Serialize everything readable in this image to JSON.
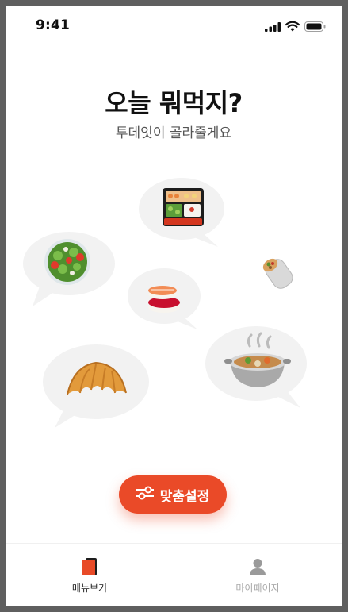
{
  "status_bar": {
    "time": "9:41"
  },
  "header": {
    "title": "오늘 뭐먹지?",
    "subtitle": "투데잇이 골라줄게요"
  },
  "food_bubbles": [
    {
      "name": "bento-box",
      "icon": "bento-box-icon"
    },
    {
      "name": "salad",
      "icon": "salad-icon"
    },
    {
      "name": "burrito",
      "icon": "burrito-icon"
    },
    {
      "name": "sushi",
      "icon": "sushi-icon"
    },
    {
      "name": "croissant",
      "icon": "croissant-icon"
    },
    {
      "name": "stew",
      "icon": "stew-icon"
    }
  ],
  "cta": {
    "label": "맞춤설정",
    "icon": "sliders-icon"
  },
  "tabbar": {
    "tabs": [
      {
        "label": "메뉴보기",
        "icon": "menu-book-icon",
        "active": true
      },
      {
        "label": "마이페이지",
        "icon": "person-icon",
        "active": false
      }
    ]
  },
  "colors": {
    "accent": "#EA4A28",
    "bubble": "#F2F2F2",
    "text_primary": "#111111",
    "text_secondary": "#555555",
    "tab_inactive": "#AAAAAA"
  }
}
